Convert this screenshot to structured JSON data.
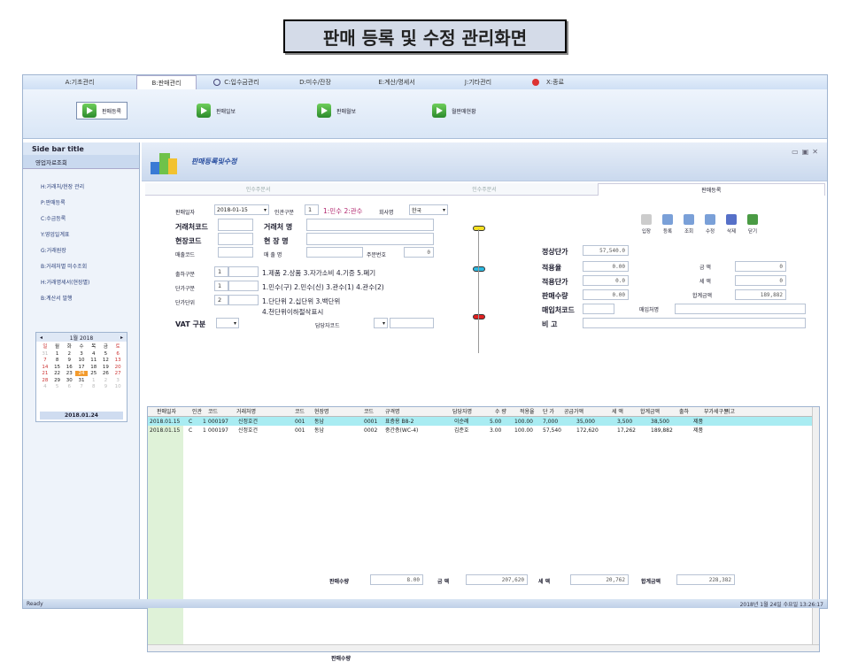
{
  "slide_title": "판매 등록 및 수정 관리화면",
  "menu": [
    {
      "label": "A:기초관리"
    },
    {
      "label": "B:판매관리"
    },
    {
      "label": "C:입수금관리"
    },
    {
      "label": "D:미수/잔장"
    },
    {
      "label": "E:계산/명세서"
    },
    {
      "label": "J:기타관리"
    },
    {
      "label": "X:종료"
    }
  ],
  "toolbar": [
    "판매등록",
    "판매일보",
    "판매월보",
    "월판매현황"
  ],
  "sidebar": {
    "title": "Side bar title",
    "section": "영업자료조회",
    "items": [
      "H:거래처/현장 관리",
      "P:판매등록",
      "C:수금등록",
      "Y:영업일계표",
      "G:거래원장",
      "B:거래처별 미수조회",
      "H:거래명세서(현장별)",
      "B:계산서 발행"
    ],
    "calendar": {
      "month": "1월 2018",
      "weekdays": [
        "일",
        "월",
        "화",
        "수",
        "목",
        "금",
        "토"
      ],
      "days": [
        [
          "31",
          "1",
          "2",
          "3",
          "4",
          "5",
          "6"
        ],
        [
          "7",
          "8",
          "9",
          "10",
          "11",
          "12",
          "13"
        ],
        [
          "14",
          "15",
          "16",
          "17",
          "18",
          "19",
          "20"
        ],
        [
          "21",
          "22",
          "23",
          "24",
          "25",
          "26",
          "27"
        ],
        [
          "28",
          "29",
          "30",
          "31",
          "1",
          "2",
          "3"
        ],
        [
          "4",
          "5",
          "6",
          "7",
          "8",
          "9",
          "10"
        ]
      ],
      "weeknums": [
        "1",
        "2",
        "3",
        "4",
        "5",
        "6"
      ],
      "today": "2018.01.24"
    }
  },
  "form": {
    "header_title": "판매등록및수정",
    "tabs": [
      "인수주문서",
      "인수주문서",
      "판매등록"
    ],
    "sale_date_label": "판매일자",
    "sale_date": "2018-01-15",
    "inout_label": "인관구분",
    "inout_value": "1",
    "inout_hint": "1:민수 2:관수",
    "company_label": "회사명",
    "company_value": "한국",
    "client_code_label": "거래처코드",
    "client_name_label": "거래처 명",
    "site_code_label": "현장코드",
    "site_name_label": "현 장 명",
    "sales_code_label": "매출코드",
    "sales_name_label": "매 출 명",
    "order_no_label": "주문번호",
    "order_no": "0",
    "ship_label": "출하구분",
    "ship_value": "1",
    "ship_hint": "1.제품 2.상품 3.자가소비 4.기증 5.폐기",
    "unit_type_label": "단가구분",
    "unit_type_value": "1",
    "unit_type_hint": "1.민수(구) 2.민수(신) 3.관수(1) 4.관수(2)",
    "unit_price_label": "단가단위",
    "unit_price_value": "2",
    "unit_price_hint": "1.단단위 2.십단위 3.백단위",
    "unit_price_hint2": "4.천단위이하절삭표시",
    "vat_label": "VAT 구분",
    "manager_code_label": "담당자코드",
    "std_price_label": "정상단가",
    "std_price": "57,540.0",
    "apply_rate_label": "적용율",
    "apply_rate": "0.00",
    "apply_price_label": "적용단가",
    "apply_price": "0.0",
    "qty_label": "판매수량",
    "qty": "0.00",
    "buy_code_label": "매입처코드",
    "buy_name_label": "매입처명",
    "note_label": "비   고",
    "amount_label": "금 액",
    "amount": "0",
    "tax_label": "세 액",
    "tax": "0",
    "total_label": "합계금액",
    "total": "189,882"
  },
  "actions": [
    "입장",
    "등록",
    "조회",
    "수정",
    "삭제",
    "닫기"
  ],
  "grid": {
    "headers": [
      "판매일자",
      "인관",
      "코드",
      "거래처명",
      "코드",
      "현장명",
      "코드",
      "규격명",
      "담당자명",
      "수 량",
      "적용율",
      "단 가",
      "공급가액",
      "세 액",
      "합계금액",
      "출하",
      "부가세구분",
      "비고"
    ],
    "rows": [
      [
        "2018.01.15",
        "C",
        "1",
        "000197",
        "신정호건",
        "001",
        "동남",
        "0001",
        "표층용 B8-2",
        "이순례",
        "5.00",
        "100.00",
        "7,000",
        "35,000",
        "3,500",
        "38,500",
        "제품"
      ],
      [
        "2018.01.15",
        "C",
        "1",
        "000197",
        "신정호건",
        "001",
        "동남",
        "0002",
        "중간층(WC-4)",
        "김준호",
        "3.00",
        "100.00",
        "57,540",
        "172,620",
        "17,262",
        "189,882",
        "제품"
      ]
    ]
  },
  "totals": {
    "qty_label": "판매수량",
    "qty": "8.00",
    "amount_label": "금 액",
    "amount": "207,620",
    "tax_label": "세 액",
    "tax": "20,762",
    "total_label": "합계금액",
    "total": "228,382"
  },
  "status": {
    "left": "Ready",
    "right": "2018년 1월 24일 수요일 13:26:17"
  }
}
